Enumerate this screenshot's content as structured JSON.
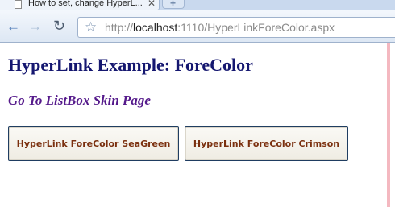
{
  "browser": {
    "tab_title": "How to set, change HyperL...",
    "tab_close": "✕",
    "new_tab": "+",
    "url_prefix": "http://",
    "url_host": "localhost",
    "url_rest": ":1110/HyperLinkForeColor.aspx"
  },
  "page": {
    "heading": "HyperLink Example: ForeColor",
    "link_text": "Go To ListBox Skin Page",
    "buttons": [
      {
        "label": "HyperLink ForeColor SeaGreen"
      },
      {
        "label": "HyperLink ForeColor Crimson"
      }
    ]
  },
  "icons": {
    "back": "back-arrow-icon",
    "forward": "forward-arrow-icon",
    "reload": "reload-icon",
    "bookmark": "star-icon"
  },
  "colors": {
    "heading": "#151770",
    "link": "#551a8b",
    "button_text": "#7a2f0e"
  }
}
